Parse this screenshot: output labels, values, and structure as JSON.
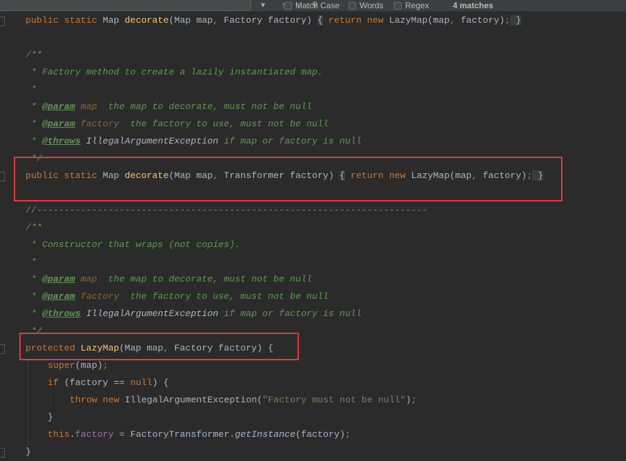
{
  "find_bar": {
    "match_case": "Match Case",
    "words": "Words",
    "regex": "Regex",
    "match_count": "4 matches"
  },
  "colors": {
    "keyword": "#cc7832",
    "function": "#ffc66d",
    "text": "#a9b7c6",
    "doc_comment": "#629755",
    "param_name": "#8a653b",
    "string": "#6a8759",
    "field": "#9876aa",
    "highlight_box": "#e8383d",
    "background": "#2b2b2b"
  },
  "lines": [
    {
      "indent": 0,
      "tokens": [
        [
          "kw",
          "public static "
        ],
        [
          "",
          "Map "
        ],
        [
          "fn",
          "decorate"
        ],
        [
          "",
          "(Map map"
        ],
        [
          "kw",
          ", "
        ],
        [
          "",
          "Factory factory) "
        ],
        [
          "br",
          "{"
        ],
        [
          "kw",
          " return new "
        ],
        [
          "",
          "LazyMap(map"
        ],
        [
          "kw",
          ", "
        ],
        [
          "",
          "factory)"
        ],
        [
          "kw",
          ";"
        ],
        [
          "br",
          " }"
        ]
      ]
    },
    {
      "indent": 0,
      "tokens": []
    },
    {
      "indent": 0,
      "tokens": [
        [
          "cm",
          "/**"
        ]
      ]
    },
    {
      "indent": 1,
      "tokens": [
        [
          "cm",
          "* Factory method to create a lazily instantiated map."
        ]
      ]
    },
    {
      "indent": 1,
      "tokens": [
        [
          "cm",
          "*"
        ]
      ]
    },
    {
      "indent": 1,
      "tokens": [
        [
          "cm",
          "* "
        ],
        [
          "tag",
          "@param"
        ],
        [
          "pn",
          " map"
        ],
        [
          "cm",
          "  the map to decorate, must not be null"
        ]
      ]
    },
    {
      "indent": 1,
      "tokens": [
        [
          "cm",
          "* "
        ],
        [
          "tag",
          "@param"
        ],
        [
          "pn",
          " factory"
        ],
        [
          "cm",
          "  the factory to use, must not be null"
        ]
      ]
    },
    {
      "indent": 1,
      "tokens": [
        [
          "cm",
          "* "
        ],
        [
          "tag",
          "@throws"
        ],
        [
          "ty",
          " IllegalArgumentException"
        ],
        [
          "cm",
          " if map or factory is null"
        ]
      ]
    },
    {
      "indent": 1,
      "tokens": [
        [
          "cm",
          "*/"
        ]
      ]
    },
    {
      "indent": 0,
      "tokens": [
        [
          "kw",
          "public static "
        ],
        [
          "",
          "Map "
        ],
        [
          "fn",
          "decorate"
        ],
        [
          "",
          "(Map map"
        ],
        [
          "kw",
          ", "
        ],
        [
          "",
          "Transformer factory) "
        ],
        [
          "br",
          "{"
        ],
        [
          "kw",
          " return new "
        ],
        [
          "",
          "LazyMap(map"
        ],
        [
          "kw",
          ", "
        ],
        [
          "",
          "factory)"
        ],
        [
          "kw",
          ";"
        ],
        [
          "br",
          " }"
        ]
      ]
    },
    {
      "indent": 0,
      "tokens": []
    },
    {
      "indent": 0,
      "tokens": [
        [
          "lc",
          "//-----------------------------------------------------------------------"
        ]
      ]
    },
    {
      "indent": 0,
      "tokens": [
        [
          "cm",
          "/**"
        ]
      ]
    },
    {
      "indent": 1,
      "tokens": [
        [
          "cm",
          "* Constructor that wraps (not copies)."
        ]
      ]
    },
    {
      "indent": 1,
      "tokens": [
        [
          "cm",
          "*"
        ]
      ]
    },
    {
      "indent": 1,
      "tokens": [
        [
          "cm",
          "* "
        ],
        [
          "tag",
          "@param"
        ],
        [
          "pn",
          " map"
        ],
        [
          "cm",
          "  the map to decorate, must not be null"
        ]
      ]
    },
    {
      "indent": 1,
      "tokens": [
        [
          "cm",
          "* "
        ],
        [
          "tag",
          "@param"
        ],
        [
          "pn",
          " factory"
        ],
        [
          "cm",
          "  the factory to use, must not be null"
        ]
      ]
    },
    {
      "indent": 1,
      "tokens": [
        [
          "cm",
          "* "
        ],
        [
          "tag",
          "@throws"
        ],
        [
          "ty",
          " IllegalArgumentException"
        ],
        [
          "cm",
          " if map or factory is null"
        ]
      ]
    },
    {
      "indent": 1,
      "tokens": [
        [
          "cm",
          "*/"
        ]
      ]
    },
    {
      "indent": 0,
      "tokens": [
        [
          "kw",
          "protected "
        ],
        [
          "fn",
          "LazyMap"
        ],
        [
          "",
          "(Map map"
        ],
        [
          "kw",
          ", "
        ],
        [
          "",
          "Factory factory) {"
        ]
      ]
    },
    {
      "indent": 4,
      "tokens": [
        [
          "kw",
          "super"
        ],
        [
          "",
          "(map)"
        ],
        [
          "kw",
          ";"
        ]
      ]
    },
    {
      "indent": 4,
      "tokens": [
        [
          "kw",
          "if "
        ],
        [
          "",
          "(factory == "
        ],
        [
          "kw",
          "null"
        ],
        [
          "",
          ") {"
        ]
      ]
    },
    {
      "indent": 8,
      "tokens": [
        [
          "kw",
          "throw new "
        ],
        [
          "",
          "IllegalArgumentException("
        ],
        [
          "str",
          "\"Factory must not be null\""
        ],
        [
          "",
          ")"
        ],
        [
          "kw",
          ";"
        ]
      ]
    },
    {
      "indent": 4,
      "tokens": [
        [
          "",
          "}"
        ]
      ]
    },
    {
      "indent": 4,
      "tokens": [
        [
          "kw",
          "this"
        ],
        [
          "",
          "."
        ],
        [
          "fld",
          "factory"
        ],
        [
          "",
          " = FactoryTransformer."
        ],
        [
          "it",
          "getInstance"
        ],
        [
          "",
          "(factory)"
        ],
        [
          "kw",
          ";"
        ]
      ]
    },
    {
      "indent": 0,
      "tokens": [
        [
          "",
          "}"
        ]
      ]
    }
  ]
}
